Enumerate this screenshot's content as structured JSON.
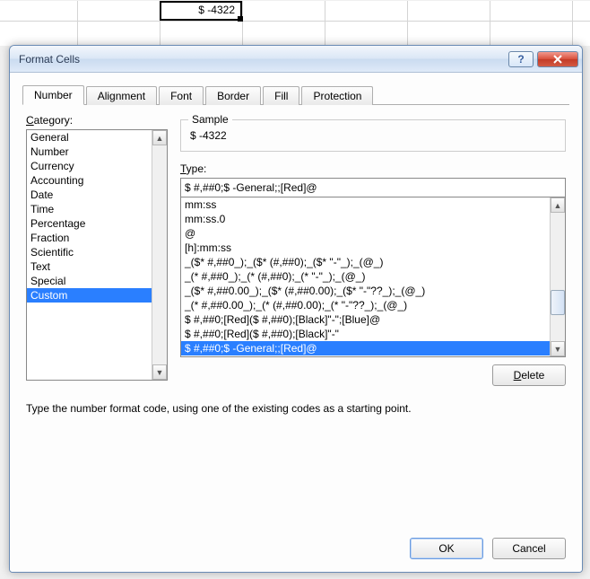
{
  "cell_value": "$ -4322",
  "dialog": {
    "title": "Format Cells",
    "tabs": [
      "Number",
      "Alignment",
      "Font",
      "Border",
      "Fill",
      "Protection"
    ],
    "active_tab": 0,
    "category_label": "Category:",
    "categories": [
      "General",
      "Number",
      "Currency",
      "Accounting",
      "Date",
      "Time",
      "Percentage",
      "Fraction",
      "Scientific",
      "Text",
      "Special",
      "Custom"
    ],
    "selected_category": 11,
    "sample_label": "Sample",
    "sample_value": "$ -4322",
    "type_label": "Type:",
    "type_value": "$ #,##0;$ -General;;[Red]@",
    "type_list": [
      "mm:ss",
      "mm:ss.0",
      "@",
      "[h]:mm:ss",
      "_($* #,##0_);_($* (#,##0);_($* \"-\"_);_(@_)",
      "_(* #,##0_);_(* (#,##0);_(* \"-\"_);_(@_)",
      "_($* #,##0.00_);_($* (#,##0.00);_($* \"-\"??_);_(@_)",
      "_(* #,##0.00_);_(* (#,##0.00);_(* \"-\"??_);_(@_)",
      "$ #,##0;[Red]($ #,##0);[Black]\"-\";[Blue]@",
      "$ #,##0;[Red]($ #,##0);[Black]\"-\"",
      "$ #,##0;$ -General;;[Red]@"
    ],
    "selected_type": 10,
    "delete_label": "Delete",
    "hint": "Type the number format code, using one of the existing codes as a starting point.",
    "ok_label": "OK",
    "cancel_label": "Cancel",
    "help_symbol": "?"
  }
}
